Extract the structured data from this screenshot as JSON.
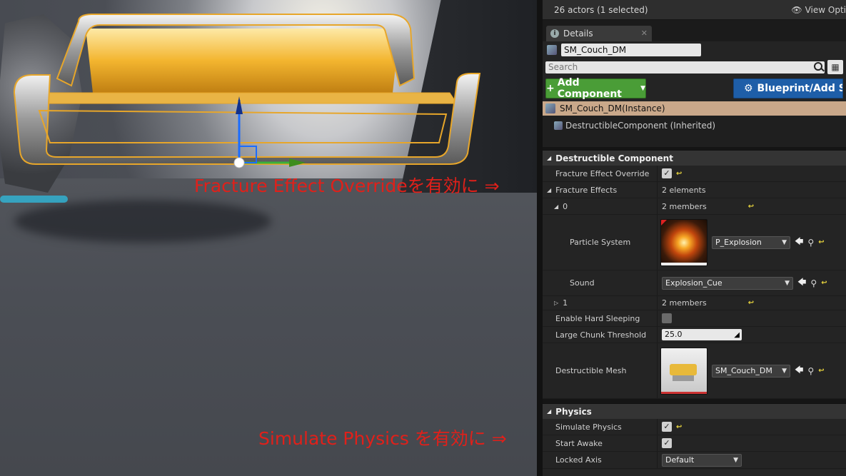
{
  "annotations": {
    "fracture": "Fracture Effect Overrideを有効に ⇒",
    "simulate": "Simulate Physics を有効に ⇒"
  },
  "topbar": {
    "actors": "26 actors (1 selected)",
    "view_options": "View Opti"
  },
  "tab": {
    "label": "Details",
    "close": "✕"
  },
  "name_field": "SM_Couch_DM",
  "search": {
    "placeholder": "Search"
  },
  "buttons": {
    "add_component": "Add Component",
    "blueprint": "Blueprint/Add Sc"
  },
  "components": {
    "instance": "SM_Couch_DM(Instance)",
    "inherited": "DestructibleComponent (Inherited)"
  },
  "destructible": {
    "header": "Destructible Component",
    "fracture_effect_override": "Fracture Effect Override",
    "fracture_effects": "Fracture Effects",
    "fracture_effects_value": "2 elements",
    "item0": "0",
    "item0_value": "2 members",
    "particle_system": "Particle System",
    "particle_value": "P_Explosion",
    "sound": "Sound",
    "sound_value": "Explosion_Cue",
    "item1": "1",
    "item1_value": "2 members",
    "enable_hard_sleeping": "Enable Hard Sleeping",
    "large_chunk_threshold": "Large Chunk Threshold",
    "large_chunk_value": "25.0",
    "destructible_mesh": "Destructible Mesh",
    "mesh_value": "SM_Couch_DM"
  },
  "physics": {
    "header": "Physics",
    "simulate_physics": "Simulate Physics",
    "start_awake": "Start Awake",
    "locked_axis": "Locked Axis",
    "locked_axis_value": "Default"
  },
  "colors": {
    "add_button": "#4a9d37",
    "blueprint_button": "#1e5ea8",
    "selection": "#c9a88a",
    "annotation": "#e0201a"
  }
}
